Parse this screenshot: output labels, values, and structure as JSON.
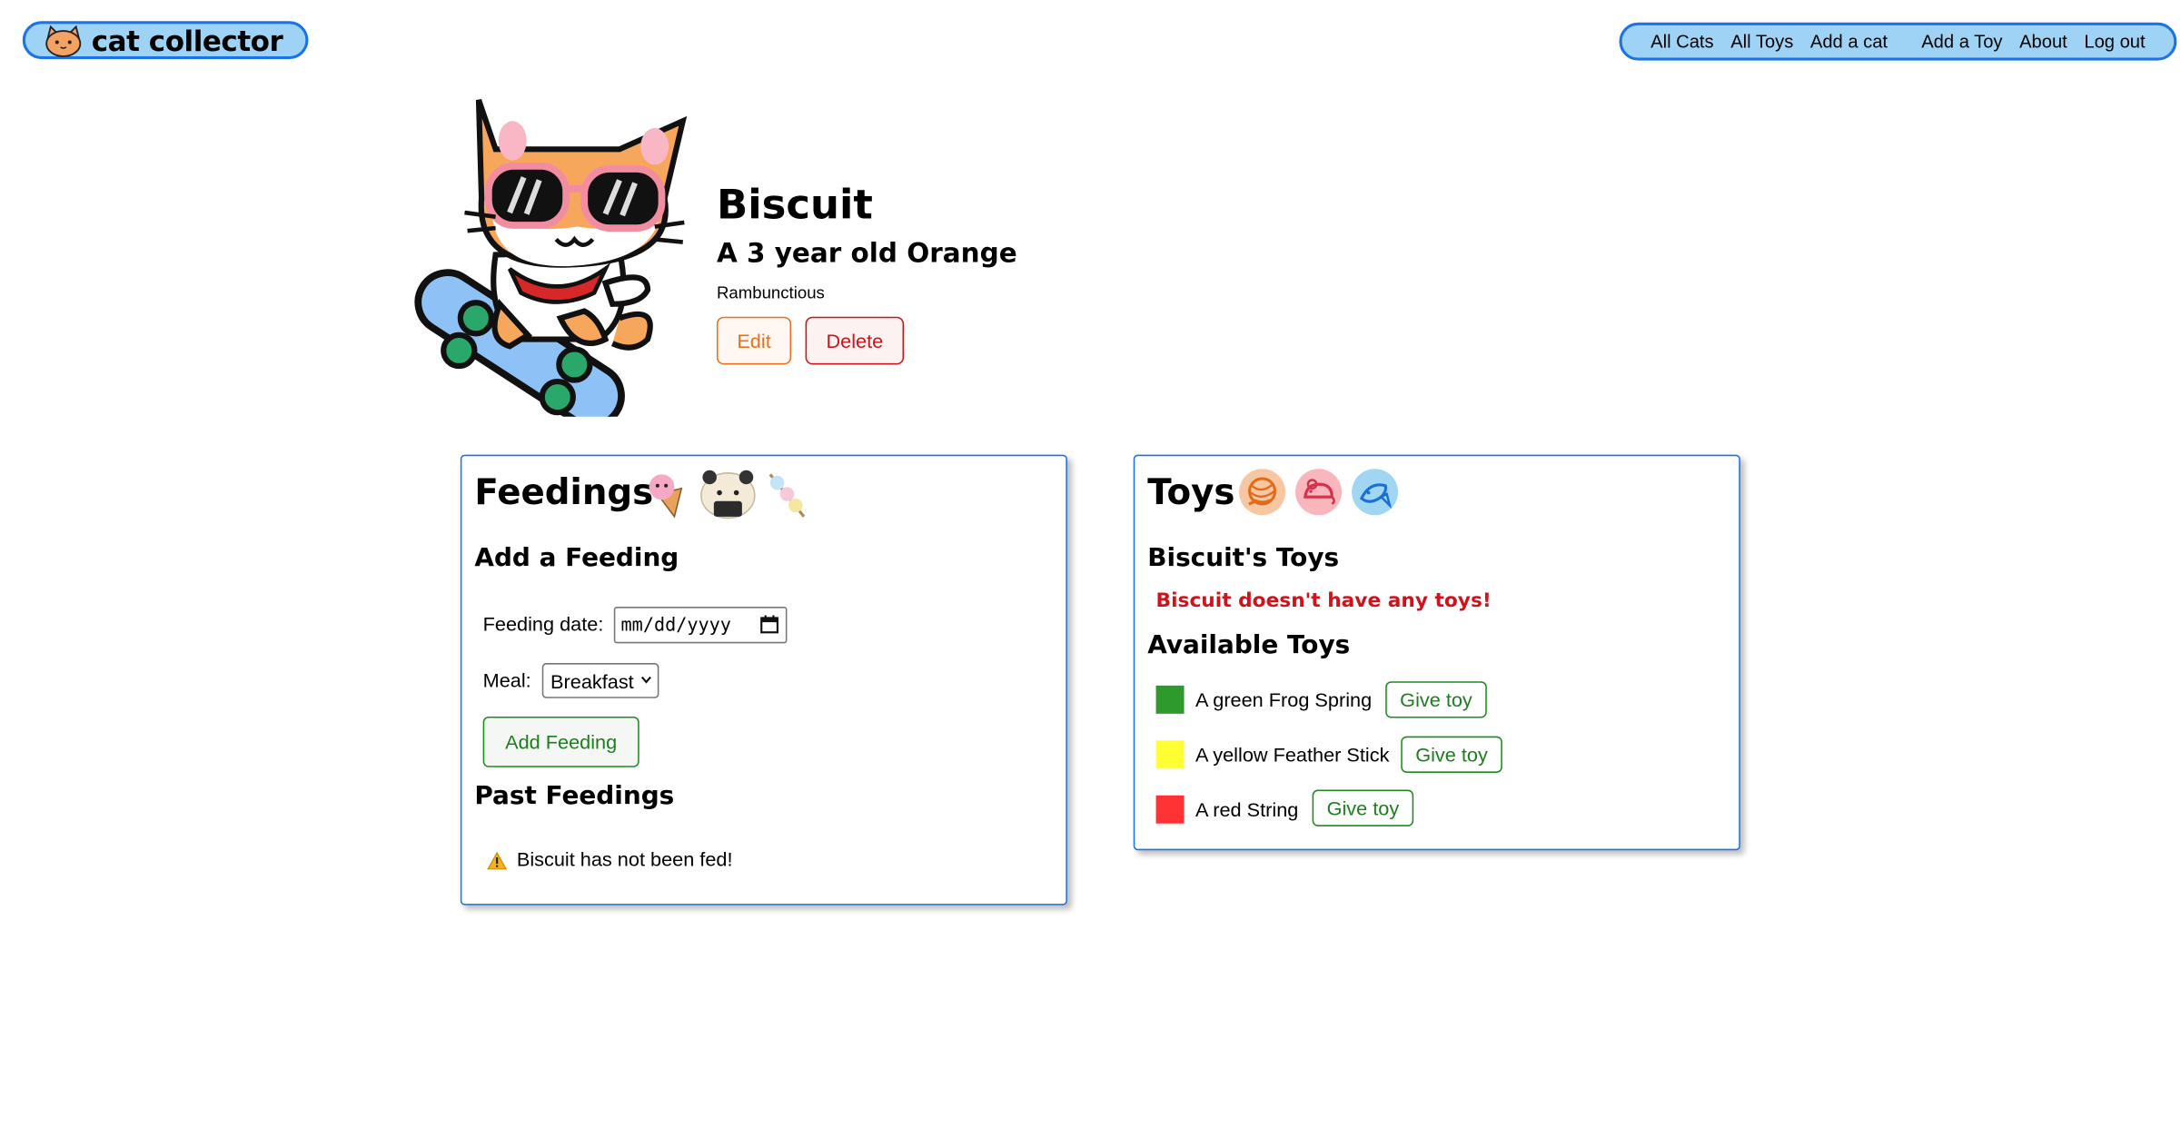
{
  "brand": {
    "name": "cat collector"
  },
  "nav": {
    "items": [
      "All Cats",
      "All Toys",
      "Add a cat",
      "Add a Toy",
      "About",
      "Log out"
    ]
  },
  "cat": {
    "name": "Biscuit",
    "description": "A 3 year old Orange",
    "temperament": "Rambunctious",
    "edit_label": "Edit",
    "delete_label": "Delete"
  },
  "feedings": {
    "title": "Feedings",
    "add_heading": "Add a Feeding",
    "date_label": "Feeding date:",
    "date_placeholder": "mm/dd/yyyy",
    "meal_label": "Meal:",
    "meal_selected": "Breakfast",
    "add_button": "Add Feeding",
    "past_heading": "Past Feedings",
    "empty_message": "Biscuit has not been fed!"
  },
  "toys": {
    "title": "Toys",
    "cat_toys_heading": "Biscuit's Toys",
    "no_toys_message": "Biscuit doesn't have any toys!",
    "available_heading": "Available Toys",
    "give_label": "Give toy",
    "available": [
      {
        "label": "A green Frog Spring",
        "color": "#2e9a2e"
      },
      {
        "label": "A yellow Feather Stick",
        "color": "#ffff33"
      },
      {
        "label": "A red String",
        "color": "#ff3333"
      }
    ]
  },
  "colors": {
    "accent_blue": "#1a73e8",
    "pill_fill": "#9fd3f5",
    "edit_orange": "#e8711a",
    "delete_red": "#d0121b",
    "green_action": "#1e8a1e"
  }
}
